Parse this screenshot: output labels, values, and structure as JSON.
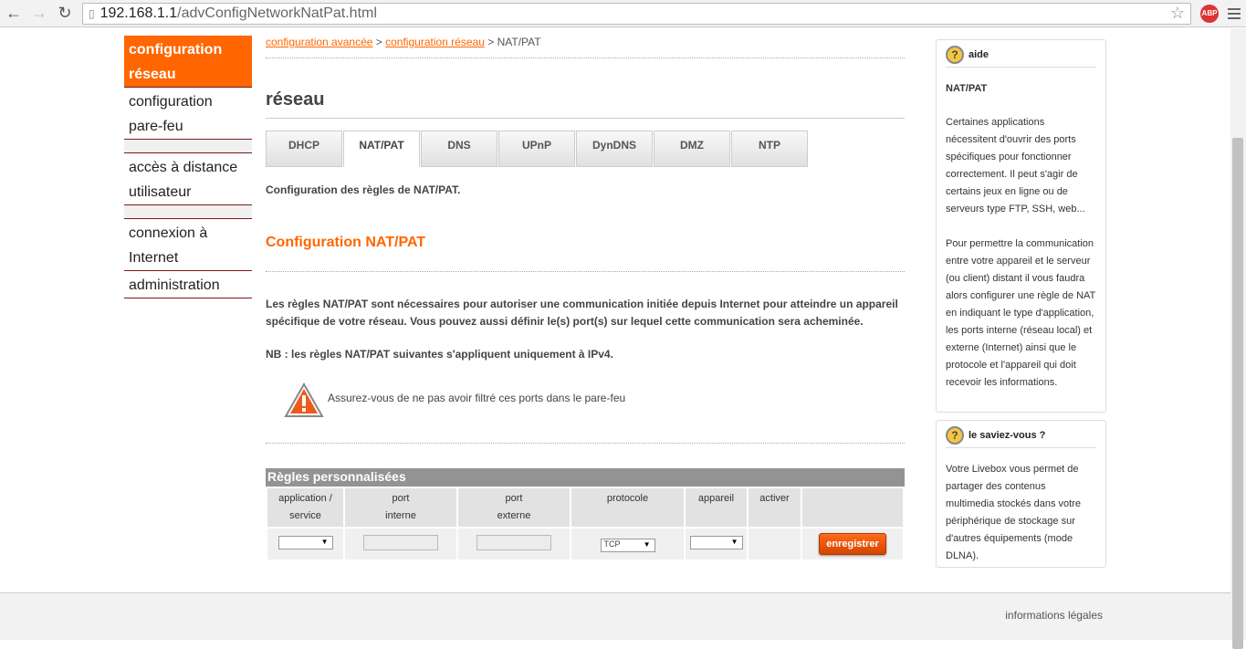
{
  "browser": {
    "url_host": "192.168.1.1",
    "url_path": "/advConfigNetworkNatPat.html",
    "abp": "ABP"
  },
  "sidebar": {
    "items": [
      {
        "label": "configuration réseau",
        "active": true
      },
      {
        "label": "configuration pare-feu"
      },
      {
        "label": "accès à distance utilisateur"
      },
      {
        "label": "connexion à Internet"
      },
      {
        "label": "administration"
      }
    ]
  },
  "breadcrumb": {
    "items": [
      "configuration avancée",
      "configuration réseau"
    ],
    "sep": ">",
    "current": "NAT/PAT"
  },
  "main": {
    "title": "réseau",
    "tabs": [
      "DHCP",
      "NAT/PAT",
      "DNS",
      "UPnP",
      "DynDNS",
      "DMZ",
      "NTP"
    ],
    "active_tab": "NAT/PAT",
    "description": "Configuration des règles de NAT/PAT.",
    "section_title": "Configuration NAT/PAT",
    "paragraph": "Les règles NAT/PAT sont nécessaires pour autoriser une communication initiée depuis Internet pour atteindre un appareil spécifique de votre réseau. Vous pouvez aussi définir le(s) port(s) sur lequel cette communication sera acheminée.",
    "nb": "NB : les règles NAT/PAT suivantes s'appliquent uniquement à IPv4.",
    "warning": "Assurez-vous de ne pas avoir filtré ces ports dans le pare-feu"
  },
  "rules": {
    "title": "Règles personnalisées",
    "headers": [
      [
        "application /",
        "service"
      ],
      [
        "port",
        "interne"
      ],
      [
        "port",
        "externe"
      ],
      [
        "protocole",
        ""
      ],
      [
        "appareil",
        ""
      ],
      [
        "activer",
        ""
      ],
      [
        ""
      ]
    ],
    "row": {
      "application": "",
      "port_interne": "",
      "port_externe": "",
      "protocole": "TCP",
      "appareil": "",
      "save": "enregistrer"
    }
  },
  "help": {
    "title": "aide",
    "subtitle": "NAT/PAT",
    "p1": "Certaines applications nécessitent d'ouvrir des ports spécifiques pour fonctionner correctement. Il peut s'agir de certains jeux en ligne ou de serveurs type FTP, SSH, web...",
    "p2": "Pour permettre la communication entre votre appareil et le serveur (ou client) distant il vous faudra alors configurer une règle de NAT en indiquant le type d'application, les ports interne (réseau local) et externe (Internet) ainsi que le protocole et l'appareil qui doit recevoir les informations."
  },
  "tip": {
    "title": "le saviez-vous ?",
    "text": "Votre Livebox vous permet de partager des contenus multimedia stockés dans votre périphérique de stockage sur d'autres équipements (mode DLNA)."
  },
  "footer": {
    "legal": "informations légales"
  },
  "colors": {
    "accent": "#ff6600",
    "sidebar_border": "#7a1a1a",
    "table_header": "#939393"
  }
}
